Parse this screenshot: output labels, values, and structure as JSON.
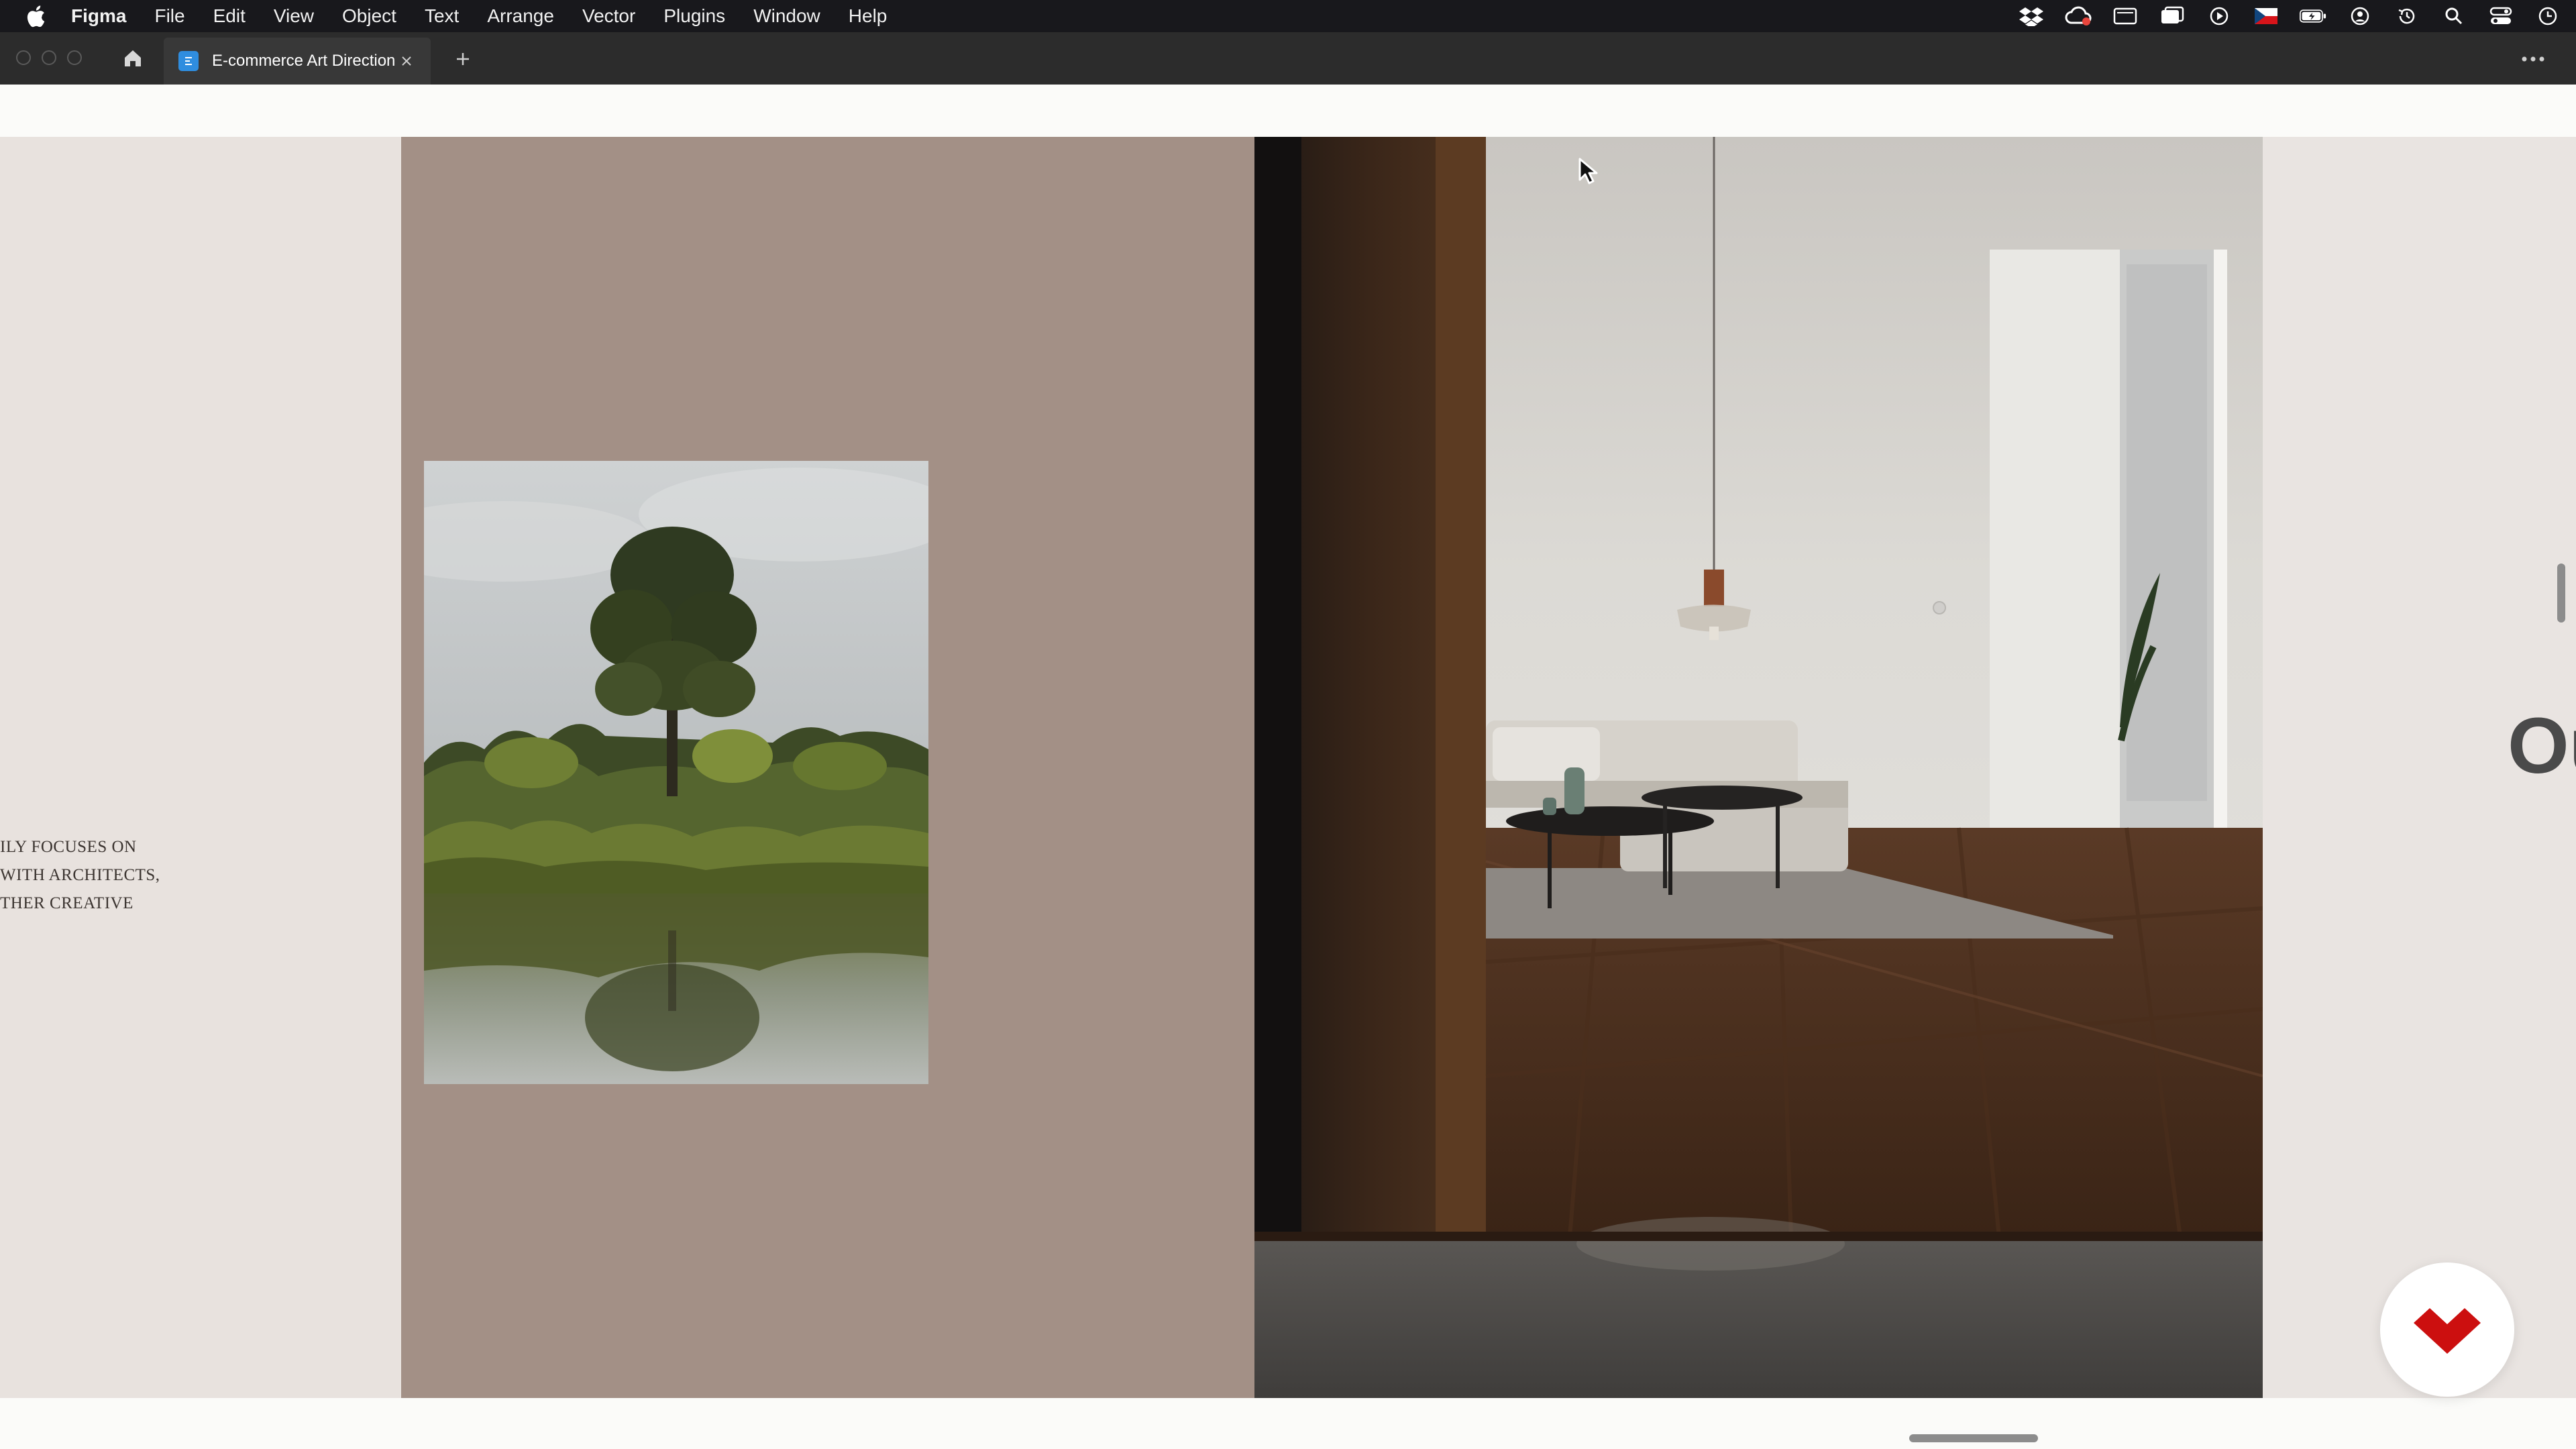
{
  "menubar": {
    "app_name": "Figma",
    "items": [
      "File",
      "Edit",
      "View",
      "Object",
      "Text",
      "Arrange",
      "Vector",
      "Plugins",
      "Window",
      "Help"
    ],
    "status_icons": [
      "dropbox-icon",
      "creative-cloud-icon",
      "display-icon",
      "photos-icon",
      "play-icon",
      "flag-icon",
      "battery-icon",
      "user-icon",
      "time-machine-icon",
      "spotlight-icon",
      "control-center-icon",
      "clock-icon"
    ]
  },
  "tabbar": {
    "tab_title": "E-commerce Art Direction"
  },
  "canvas": {
    "left_copy": [
      "ILY FOCUSES ON",
      "WITH ARCHITECTS,",
      "THER CREATIVE"
    ],
    "right_heading": "Ou",
    "colors": {
      "left_panel": "#e8e2de",
      "taupe_panel": "#a39086",
      "right_panel": "#e9e4e1",
      "logo_red": "#cc0f0f"
    }
  }
}
